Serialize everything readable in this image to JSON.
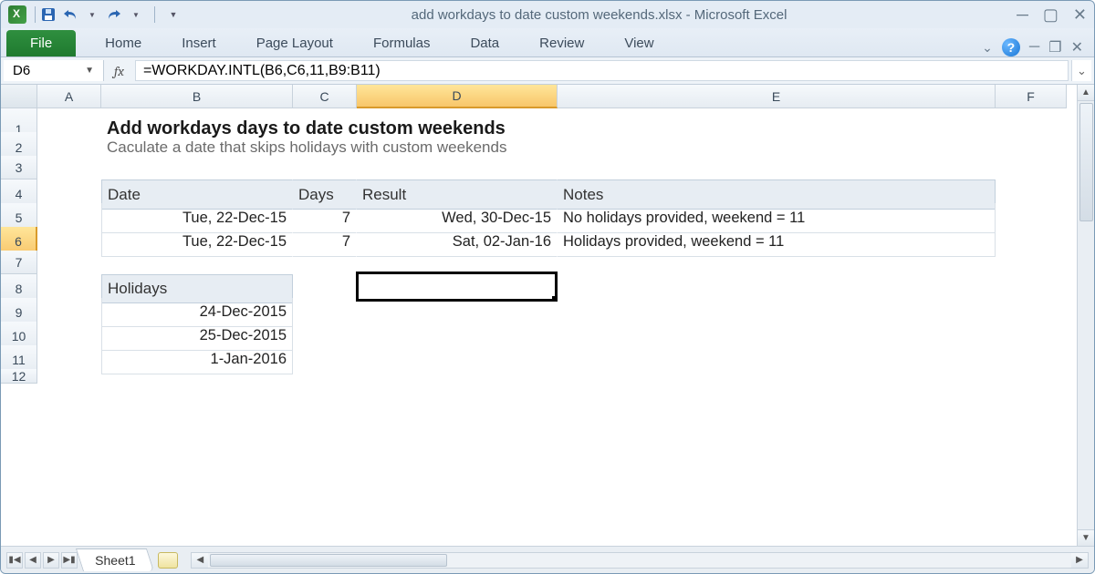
{
  "window": {
    "title": "add workdays to date custom weekends.xlsx  -  Microsoft Excel"
  },
  "ribbon": {
    "file": "File",
    "tabs": [
      "Home",
      "Insert",
      "Page Layout",
      "Formulas",
      "Data",
      "Review",
      "View"
    ]
  },
  "formula_bar": {
    "name_box": "D6",
    "fx": "fx",
    "formula": "=WORKDAY.INTL(B6,C6,11,B9:B11)"
  },
  "columns": [
    "A",
    "B",
    "C",
    "D",
    "E",
    "F"
  ],
  "rows": [
    "1",
    "2",
    "3",
    "4",
    "5",
    "6",
    "7",
    "8",
    "9",
    "10",
    "11",
    "12"
  ],
  "selected": {
    "col": "D",
    "row": "6"
  },
  "content": {
    "title": "Add workdays days to date custom weekends",
    "subtitle": "Caculate a date that skips holidays with custom weekends",
    "table1": {
      "headers": [
        "Date",
        "Days",
        "Result",
        "Notes"
      ],
      "rows": [
        {
          "date": "Tue, 22-Dec-15",
          "days": "7",
          "result": "Wed, 30-Dec-15",
          "notes": "No holidays provided, weekend = 11"
        },
        {
          "date": "Tue, 22-Dec-15",
          "days": "7",
          "result": "Sat, 02-Jan-16",
          "notes": "Holidays provided, weekend = 11"
        }
      ]
    },
    "holidays": {
      "header": "Holidays",
      "values": [
        "24-Dec-2015",
        "25-Dec-2015",
        "1-Jan-2016"
      ]
    }
  },
  "sheet_tabs": {
    "active": "Sheet1"
  }
}
